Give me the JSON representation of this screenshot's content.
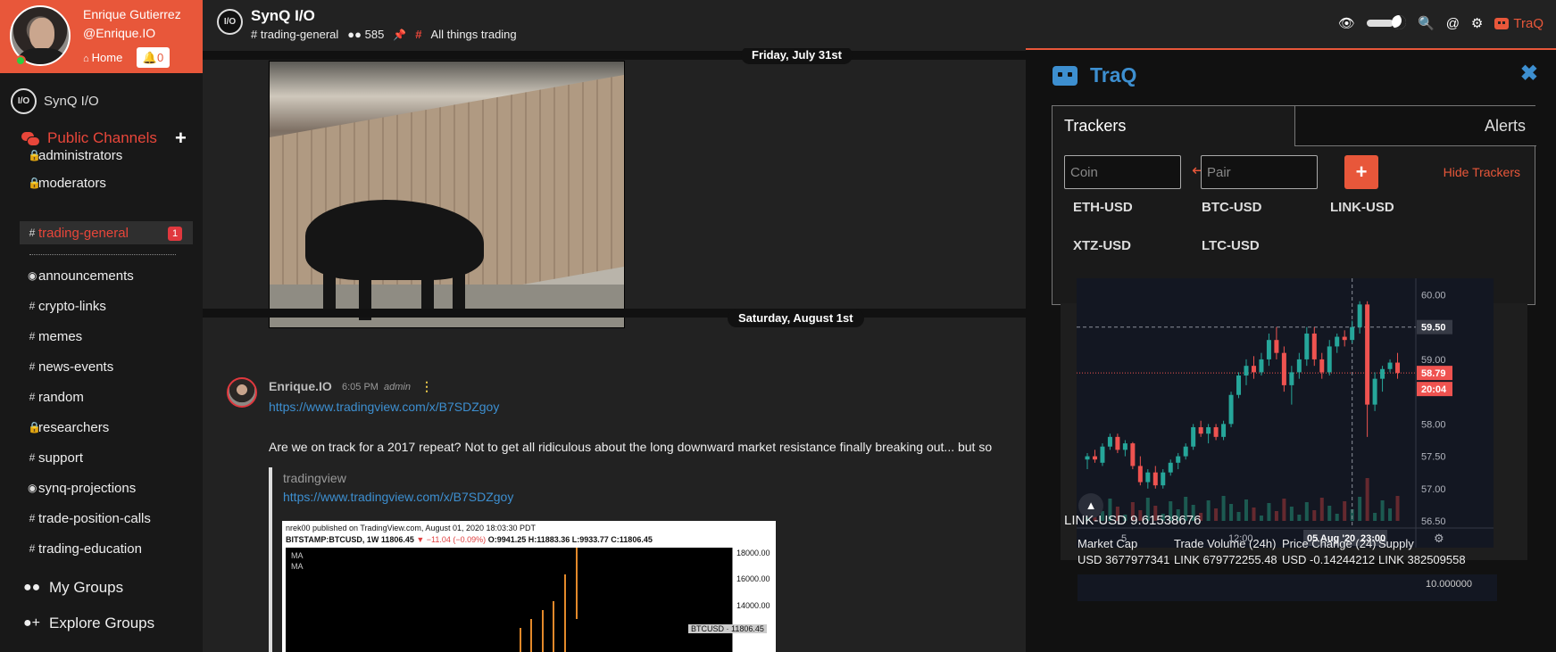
{
  "user": {
    "name": "Enrique Gutierrez",
    "handle": "@Enrique.IO",
    "home_label": "Home",
    "notifications": "0"
  },
  "server": {
    "name": "SynQ I/O",
    "logo_text": "I/O"
  },
  "sidebar": {
    "section_title": "Public Channels",
    "channels": [
      {
        "prefix": "lock-icon",
        "label": "administrators"
      },
      {
        "prefix": "lock-icon",
        "label": "moderators"
      },
      {
        "prefix": "#",
        "label": "trading-general",
        "badge": "1"
      },
      {
        "prefix": "eye-icon",
        "label": "announcements"
      },
      {
        "prefix": "#",
        "label": "crypto-links"
      },
      {
        "prefix": "#",
        "label": "memes"
      },
      {
        "prefix": "#",
        "label": "news-events"
      },
      {
        "prefix": "#",
        "label": "random"
      },
      {
        "prefix": "lock-icon",
        "label": "researchers"
      },
      {
        "prefix": "#",
        "label": "support"
      },
      {
        "prefix": "eye-icon",
        "label": "synq-projections"
      },
      {
        "prefix": "#",
        "label": "trade-position-calls"
      },
      {
        "prefix": "#",
        "label": "trading-education"
      }
    ],
    "my_groups": "My Groups",
    "explore_groups": "Explore Groups"
  },
  "header": {
    "title": "SynQ I/O",
    "channel": "trading-general",
    "members": "585",
    "topic": "All things trading",
    "traq_label": "TraQ"
  },
  "chat": {
    "date1": "Friday, July 31st",
    "date2": "Saturday, August 1st",
    "message": {
      "author": "Enrique.IO",
      "time": "6:05 PM",
      "role": "admin",
      "link": "https://www.tradingview.com/x/B7SDZgoy",
      "text": "Are we on track for a 2017 repeat? Not to get all ridiculous about the long downward market resistance finally breaking out... but so",
      "embed_site": "tradingview",
      "embed_link": "https://www.tradingview.com/x/B7SDZgoy",
      "embed_header1": "nrek00 published on TradingView.com, August 01, 2020 18:03:30 PDT",
      "embed_header2": "BITSTAMP:BTCUSD, 1W 11806.45",
      "embed_change": "▼ −11.04 (−0.09%)",
      "embed_ohlc": "O:9941.25 H:11883.36 L:9933.77 C:11806.45",
      "embed_ma1": "MA",
      "embed_ma2": "MA",
      "embed_y": [
        "18000.00",
        "16000.00",
        "14000.00"
      ],
      "embed_price_tag": "BTCUSD · 11806.45"
    }
  },
  "traq": {
    "title": "TraQ",
    "tab_trackers": "Trackers",
    "tab_alerts": "Alerts",
    "coin_placeholder": "Coin",
    "pair_placeholder": "Pair",
    "hide_label": "Hide Trackers",
    "pairs": [
      "ETH-USD",
      "BTC-USD",
      "LINK-USD",
      "XTZ-USD",
      "LTC-USD"
    ],
    "summary": "LINK-USD 9.61538676",
    "stats": [
      {
        "label": "Market Cap",
        "value": "USD 3677977341"
      },
      {
        "label": "Trade Volume (24h)",
        "value": "LINK 679772255.48"
      },
      {
        "label": "Price Change (24)",
        "value": "USD -0.14244212"
      },
      {
        "label": "Supply",
        "value": "LINK 382509558"
      }
    ],
    "bottom_tick": "10.000000"
  },
  "chart_data": {
    "type": "candlestick",
    "y_ticks": [
      "60.00",
      "59.00",
      "58.00",
      "57.50",
      "57.00",
      "56.50"
    ],
    "x_ticks": [
      "5",
      "12:00",
      "05 Aug '20",
      "23:00"
    ],
    "crosshair_price": "59.50",
    "last_price": "58.79",
    "countdown": "20:04",
    "ylim": [
      56.5,
      60.2
    ],
    "candles": [
      [
        57.45,
        57.55,
        57.3,
        57.5
      ],
      [
        57.5,
        57.6,
        57.4,
        57.45
      ],
      [
        57.4,
        57.7,
        57.35,
        57.65
      ],
      [
        57.65,
        57.85,
        57.6,
        57.8
      ],
      [
        57.8,
        57.85,
        57.55,
        57.6
      ],
      [
        57.6,
        57.75,
        57.5,
        57.7
      ],
      [
        57.7,
        57.72,
        57.3,
        57.35
      ],
      [
        57.35,
        57.5,
        57.05,
        57.1
      ],
      [
        57.1,
        57.3,
        57.0,
        57.25
      ],
      [
        57.25,
        57.35,
        57.0,
        57.05
      ],
      [
        57.05,
        57.3,
        57.0,
        57.25
      ],
      [
        57.25,
        57.45,
        57.2,
        57.4
      ],
      [
        57.4,
        57.55,
        57.3,
        57.5
      ],
      [
        57.5,
        57.7,
        57.45,
        57.65
      ],
      [
        57.65,
        58.0,
        57.6,
        57.95
      ],
      [
        57.95,
        58.05,
        57.8,
        57.85
      ],
      [
        57.85,
        58.0,
        57.7,
        57.95
      ],
      [
        57.95,
        58.0,
        57.75,
        57.8
      ],
      [
        57.8,
        58.05,
        57.75,
        58.0
      ],
      [
        58.0,
        58.5,
        57.95,
        58.45
      ],
      [
        58.45,
        58.8,
        58.4,
        58.75
      ],
      [
        58.75,
        59.0,
        58.6,
        58.9
      ],
      [
        58.9,
        59.05,
        58.7,
        58.8
      ],
      [
        58.8,
        59.1,
        58.75,
        59.0
      ],
      [
        59.0,
        59.4,
        58.9,
        59.3
      ],
      [
        59.3,
        59.5,
        59.0,
        59.1
      ],
      [
        59.1,
        59.2,
        58.5,
        58.6
      ],
      [
        58.6,
        58.9,
        58.3,
        58.8
      ],
      [
        58.8,
        59.1,
        58.7,
        59.0
      ],
      [
        59.0,
        59.5,
        58.9,
        59.4
      ],
      [
        59.4,
        59.5,
        58.9,
        59.0
      ],
      [
        59.0,
        59.1,
        58.7,
        58.8
      ],
      [
        58.8,
        59.3,
        58.75,
        59.2
      ],
      [
        59.2,
        59.4,
        59.1,
        59.35
      ],
      [
        59.35,
        59.45,
        59.2,
        59.3
      ],
      [
        59.3,
        59.6,
        59.25,
        59.5
      ],
      [
        59.5,
        59.9,
        59.4,
        59.85
      ],
      [
        59.85,
        59.9,
        57.8,
        58.3
      ],
      [
        58.3,
        58.8,
        58.2,
        58.7
      ],
      [
        58.7,
        58.9,
        58.5,
        58.85
      ],
      [
        58.85,
        59.0,
        58.8,
        58.95
      ],
      [
        58.95,
        59.1,
        58.7,
        58.79
      ]
    ]
  }
}
